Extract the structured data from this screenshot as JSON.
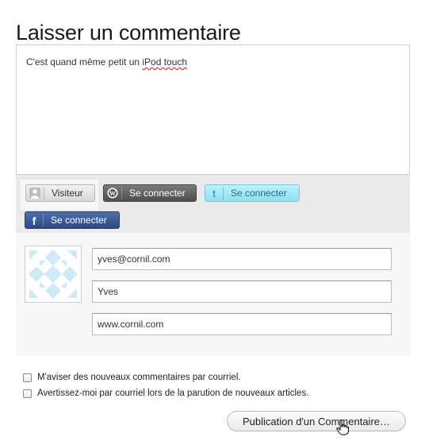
{
  "page": {
    "title": "Laisser un commentaire"
  },
  "comment": {
    "text_before": "C'est quand même petit un ",
    "misspelled": "iPod touch"
  },
  "login": {
    "visitor_label": "Visiteur",
    "wordpress_label": "Se connecter",
    "twitter_label": "Se connecter",
    "facebook_label": "Se connecter"
  },
  "form": {
    "email": "yves@cornil.com",
    "name": "Yves",
    "website": "www.cornil.com"
  },
  "options": {
    "notify_comments": "M'aviser des nouveaux commentaires par courriel.",
    "notify_articles": "Avertissez-moi par courriel lors de la parution de nouveaux articles."
  },
  "submit_label": "Publication d'un Commentaire…",
  "colors": {
    "twitter": "#8fdff3",
    "facebook": "#2c4a85",
    "wordpress": "#4f4f4f",
    "avatar_pattern": "#cdeaf6"
  },
  "icons": [
    "user-icon",
    "wordpress-icon",
    "twitter-icon",
    "facebook-icon",
    "identicon-avatar",
    "hand-cursor-icon"
  ]
}
